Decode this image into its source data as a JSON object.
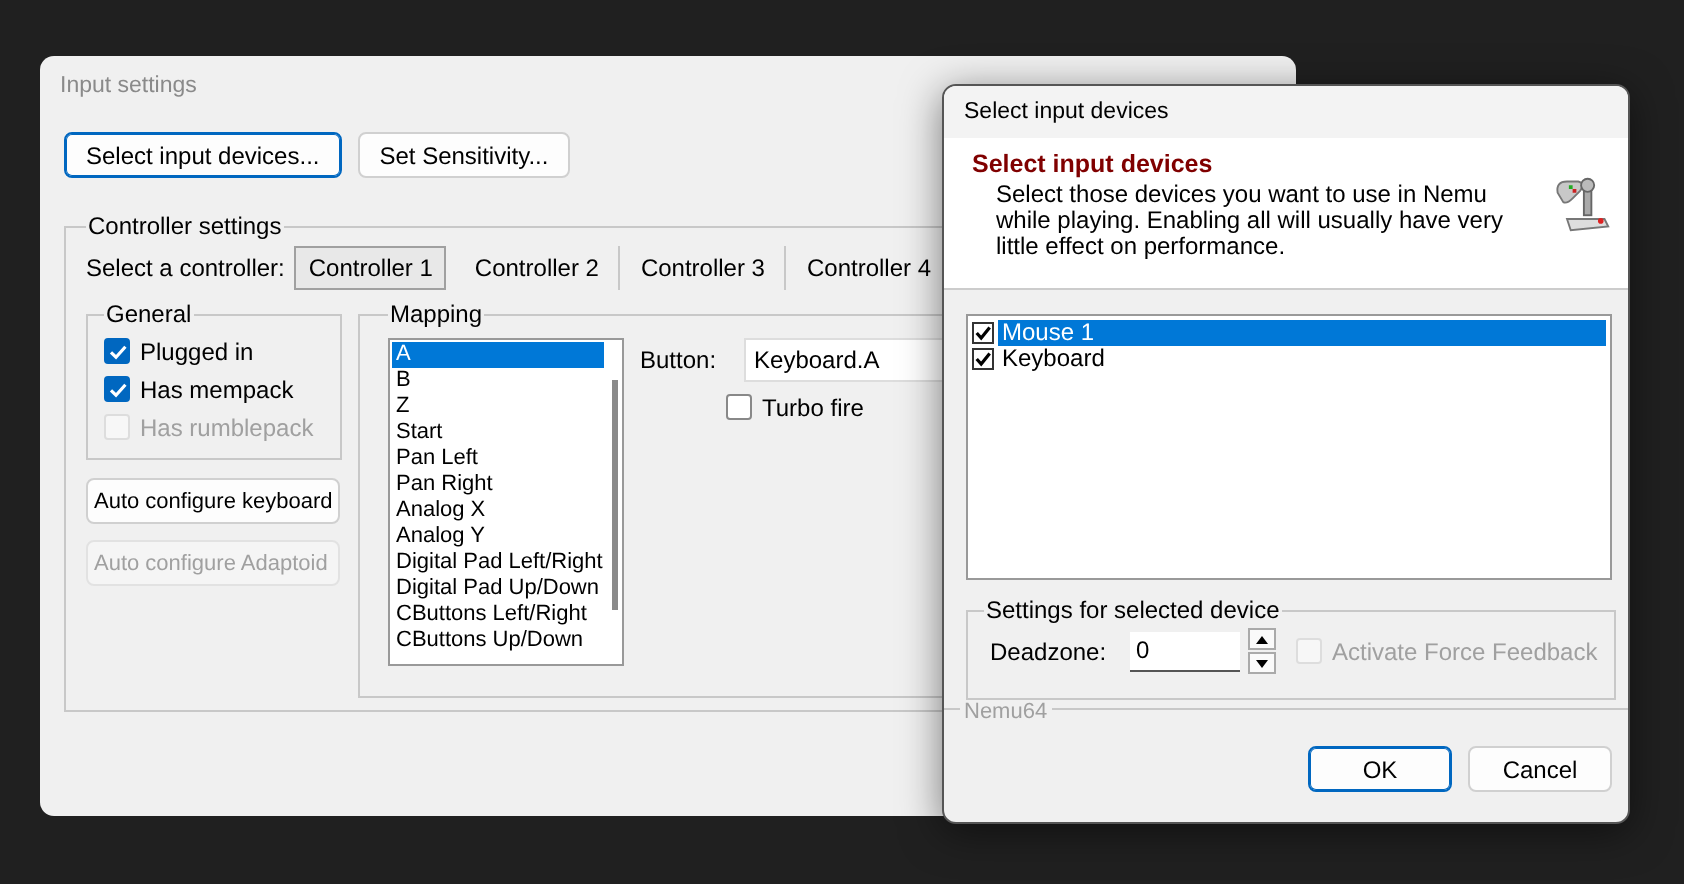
{
  "main_window": {
    "title": "Input settings",
    "buttons": [
      {
        "label": "Select input devices...",
        "default": true
      },
      {
        "label": "Set Sensitivity...",
        "default": false
      }
    ],
    "controller_settings": {
      "label": "Controller settings",
      "prompt": "Select a controller:",
      "tabs": [
        {
          "label": "Controller 1",
          "selected": true
        },
        {
          "label": "Controller 2",
          "selected": false
        },
        {
          "label": "Controller 3",
          "selected": false
        },
        {
          "label": "Controller 4",
          "selected": false
        }
      ],
      "general": {
        "label": "General",
        "checkboxes": [
          {
            "label": "Plugged in",
            "checked": true,
            "disabled": false
          },
          {
            "label": "Has mempack",
            "checked": true,
            "disabled": false
          },
          {
            "label": "Has rumblepack",
            "checked": false,
            "disabled": true
          }
        ]
      },
      "auto_buttons": [
        {
          "label": "Auto configure keyboard",
          "disabled": false
        },
        {
          "label": "Auto configure Adaptoid",
          "disabled": true
        }
      ],
      "mapping": {
        "label": "Mapping",
        "items": [
          {
            "label": "A",
            "selected": true
          },
          {
            "label": "B",
            "selected": false
          },
          {
            "label": "Z",
            "selected": false
          },
          {
            "label": "Start",
            "selected": false
          },
          {
            "label": "Pan Left",
            "selected": false
          },
          {
            "label": "Pan Right",
            "selected": false
          },
          {
            "label": "Analog X",
            "selected": false
          },
          {
            "label": "Analog Y",
            "selected": false
          },
          {
            "label": "Digital Pad Left/Right",
            "selected": false
          },
          {
            "label": "Digital Pad Up/Down",
            "selected": false
          },
          {
            "label": "CButtons Left/Right",
            "selected": false
          },
          {
            "label": "CButtons Up/Down",
            "selected": false
          }
        ],
        "button_label": "Button:",
        "button_value": "Keyboard.A",
        "turbo": {
          "label": "Turbo fire",
          "checked": false
        }
      }
    }
  },
  "dialog": {
    "title": "Select input devices",
    "header": {
      "heading": "Select input devices",
      "description": "Select those devices you want to use in Nemu while playing. Enabling all will usually have very little effect on performance."
    },
    "devices": [
      {
        "label": "Mouse 1",
        "checked": true,
        "selected": true
      },
      {
        "label": "Keyboard",
        "checked": true,
        "selected": false
      }
    ],
    "settings": {
      "label": "Settings for selected device",
      "deadzone_label": "Deadzone:",
      "deadzone_value": "0",
      "force_feedback": {
        "label": "Activate Force Feedback",
        "checked": false,
        "disabled": true
      }
    },
    "brand": "Nemu64",
    "buttons": [
      {
        "label": "OK",
        "default": true
      },
      {
        "label": "Cancel",
        "default": false
      }
    ]
  }
}
